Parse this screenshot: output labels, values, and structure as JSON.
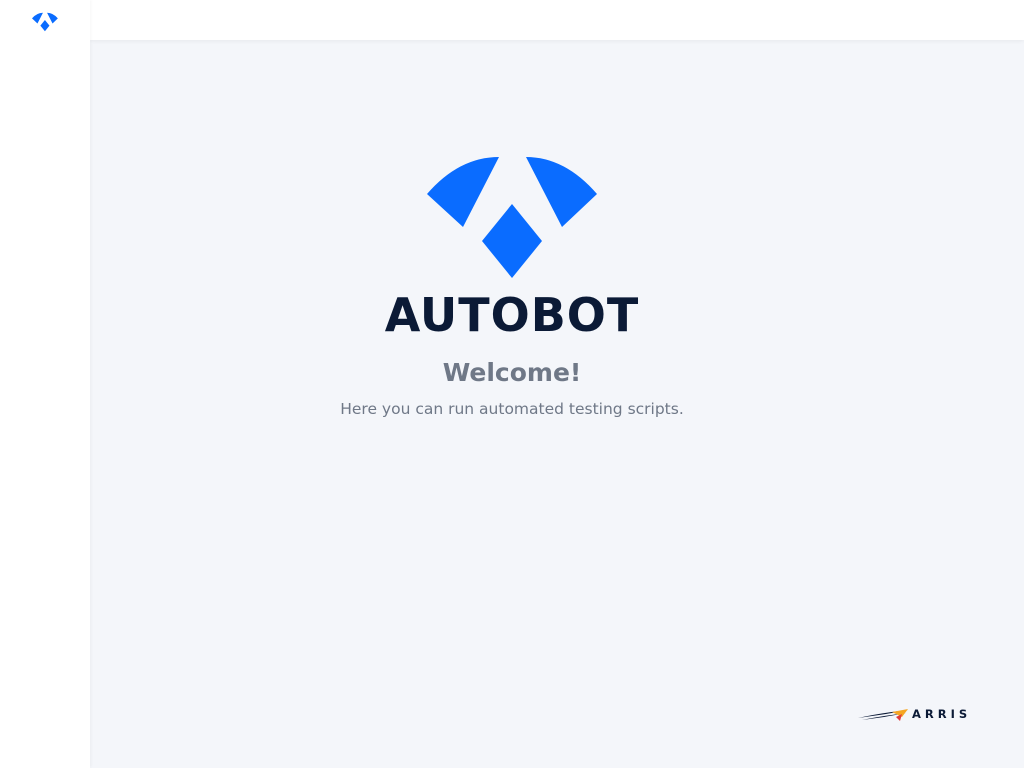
{
  "sidebar": {
    "logo_icon": "autobot-logo-icon"
  },
  "main": {
    "hero_icon": "autobot-logo-icon",
    "brand_name": "AUTOBOT",
    "welcome_title": "Welcome!",
    "welcome_subtitle": "Here you can run automated testing scripts."
  },
  "footer": {
    "brand_name": "ARRIS",
    "swoosh_icon": "arris-swoosh-icon"
  },
  "colors": {
    "brand_blue": "#0a6cff",
    "navy": "#0b1a36",
    "muted_text": "#6f7887",
    "background": "#f4f6fa",
    "swoosh_orange": "#f5a623",
    "swoosh_red": "#e03a3a"
  }
}
